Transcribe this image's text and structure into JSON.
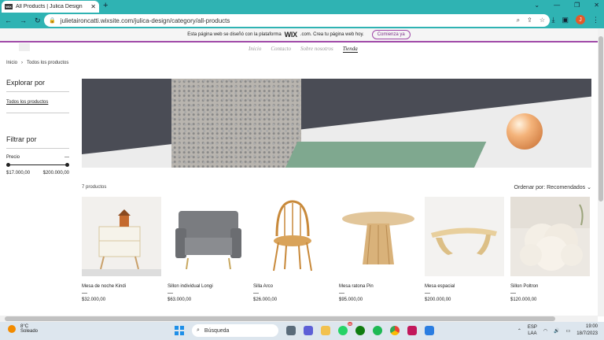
{
  "browser": {
    "tab_title": "All Products | Julica Design",
    "tab_favicon": "WIX",
    "url": "julietaironcatti.wixsite.com/julica-design/category/all-products",
    "avatar_letter": "J"
  },
  "wix_banner": {
    "text": "Esta página web se diseñó con la plataforma",
    "brand": "WIX",
    "suffix": ".com. Crea tu página web hoy.",
    "button": "Comienza ya"
  },
  "site_menu": [
    "Inicio",
    "Contacto",
    "Sobre nosotros",
    "Tienda"
  ],
  "breadcrumb": {
    "home": "Inicio",
    "current": "Todos los productos"
  },
  "sidebar": {
    "explore_title": "Explorar por",
    "explore_link": "Todos los productos",
    "filter_title": "Filtrar por",
    "price_label": "Precio",
    "price_min": "$17.000,00",
    "price_max": "$200.000,00"
  },
  "products_count": "7 productos",
  "sort_label": "Ordenar por: Recomendados",
  "products": [
    {
      "name": "Mesa de noche Kindi",
      "price": "$32.000,00"
    },
    {
      "name": "Sillon individual Longi",
      "price": "$63.000,00"
    },
    {
      "name": "Silla Arco",
      "price": "$26.000,00"
    },
    {
      "name": "Mesa ratona Pin",
      "price": "$95.000,00"
    },
    {
      "name": "Mesa espacial",
      "price": "$200.000,00"
    },
    {
      "name": "Sillon Poltron",
      "price": "$120.000,00"
    }
  ],
  "taskbar": {
    "temp": "8°C",
    "weather": "Soleado",
    "search": "Búsqueda",
    "lang": "ESP",
    "region": "LAA",
    "time": "19:00",
    "date": "18/7/2023",
    "badge_whatsapp": "30"
  }
}
